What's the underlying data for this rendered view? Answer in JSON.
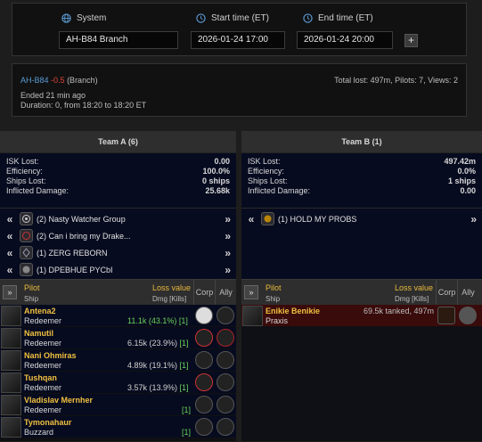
{
  "form": {
    "system_label": "System",
    "start_label": "Start time (ET)",
    "end_label": "End time (ET)",
    "system_value": "AH-B84  Branch",
    "start_value": "2026-01-24 17:00",
    "end_value": "2026-01-24 20:00",
    "add_label": "+"
  },
  "summary": {
    "system_name": "AH-B84",
    "security": "-0.5",
    "region": "(Branch)",
    "totals": "Total lost: 497m, Pilots: 7, Views: 2",
    "ended": "Ended 21 min ago",
    "duration": "Duration: 0, from 18:20 to 18:20 ET"
  },
  "team_a": {
    "title": "Team A (6)",
    "stats": [
      {
        "k": "ISK Lost:",
        "v": "0.00"
      },
      {
        "k": "Efficiency:",
        "v": "100.0%"
      },
      {
        "k": "Ships Lost:",
        "v": "0 ships"
      },
      {
        "k": "Inflicted Damage:",
        "v": "25.68k"
      }
    ],
    "groups": [
      {
        "label": "(2)  Nasty Watcher Group"
      },
      {
        "label": "(2)  Can i bring my Drake..."
      },
      {
        "label": "(1)  ZERG REBORN"
      },
      {
        "label": "(1)  DPEBHUE PYCbI"
      }
    ],
    "head": {
      "pilot": "Pilot",
      "ship": "Ship",
      "loss": "Loss value",
      "dmg": "Dmg [Kills]",
      "corp": "Corp",
      "ally": "Ally",
      "sort": "»"
    },
    "pilots": [
      {
        "name": "Antena2",
        "ship": "Redeemer",
        "dmg": "11.1k (43.1%)",
        "kills": "[1]"
      },
      {
        "name": "Namutil",
        "ship": "Redeemer",
        "dmg": "6.15k (23.9%)",
        "kills": "[1]"
      },
      {
        "name": "Nani Ohmiras",
        "ship": "Redeemer",
        "dmg": "4.89k (19.1%)",
        "kills": "[1]"
      },
      {
        "name": "Tushqan",
        "ship": "Redeemer",
        "dmg": "3.57k (13.9%)",
        "kills": "[1]"
      },
      {
        "name": "Vladislav Mernher",
        "ship": "Redeemer",
        "dmg": "",
        "kills": "[1]"
      },
      {
        "name": "Tymonahaur",
        "ship": "Buzzard",
        "dmg": "",
        "kills": "[1]"
      }
    ]
  },
  "team_b": {
    "title": "Team B (1)",
    "stats": [
      {
        "k": "ISK Lost:",
        "v": "497.42m"
      },
      {
        "k": "Efficiency:",
        "v": "0.0%"
      },
      {
        "k": "Ships Lost:",
        "v": "1 ships"
      },
      {
        "k": "Inflicted Damage:",
        "v": "0.00"
      }
    ],
    "groups": [
      {
        "label": "(1)  HOLD MY PROBS"
      }
    ],
    "head": {
      "pilot": "Pilot",
      "ship": "Ship",
      "loss": "Loss value",
      "dmg": "Dmg [Kills]",
      "corp": "Corp",
      "ally": "Ally",
      "sort": "»"
    },
    "pilots": [
      {
        "name": "Enikie Benikie",
        "ship": "Praxis",
        "tank": "69.5k tanked, 497m"
      }
    ]
  }
}
